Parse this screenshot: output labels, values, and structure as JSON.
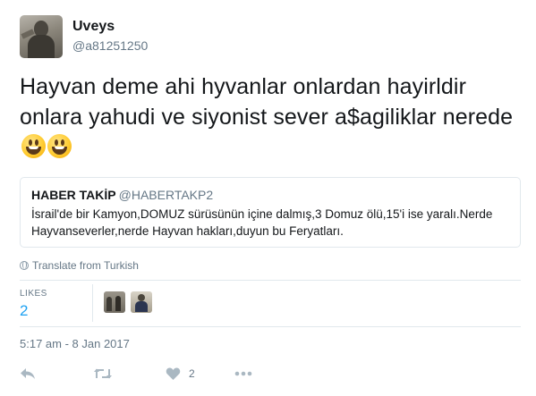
{
  "user": {
    "display_name": "Uveys",
    "screen_name": "@a81251250"
  },
  "tweet": {
    "text": "Hayvan deme ahi hyvanlar onlardan hayirldir onlara yahudi ve siyonist sever a$agiliklar nerede",
    "emoji": [
      "grinning-face",
      "grinning-face"
    ]
  },
  "quoted_tweet": {
    "name": "HABER TAKİP",
    "handle": "@HABERTAKP2",
    "text": "İsrail'de bir Kamyon,DOMUZ sürüsünün içine dalmış,3 Domuz ölü,15'i ise yaralı.Nerde Hayvanseverler,nerde Hayvan hakları,duyun bu Feryatları."
  },
  "translate": {
    "label": "Translate from Turkish"
  },
  "stats": {
    "likes_label": "LIKES",
    "likes_value": "2"
  },
  "timestamp": "5:17 am - 8 Jan 2017",
  "actions": {
    "like_count": "2"
  },
  "colors": {
    "link": "#1da1f2",
    "muted": "#657786",
    "icon": "#aab8c2",
    "border": "#e1e8ed"
  }
}
